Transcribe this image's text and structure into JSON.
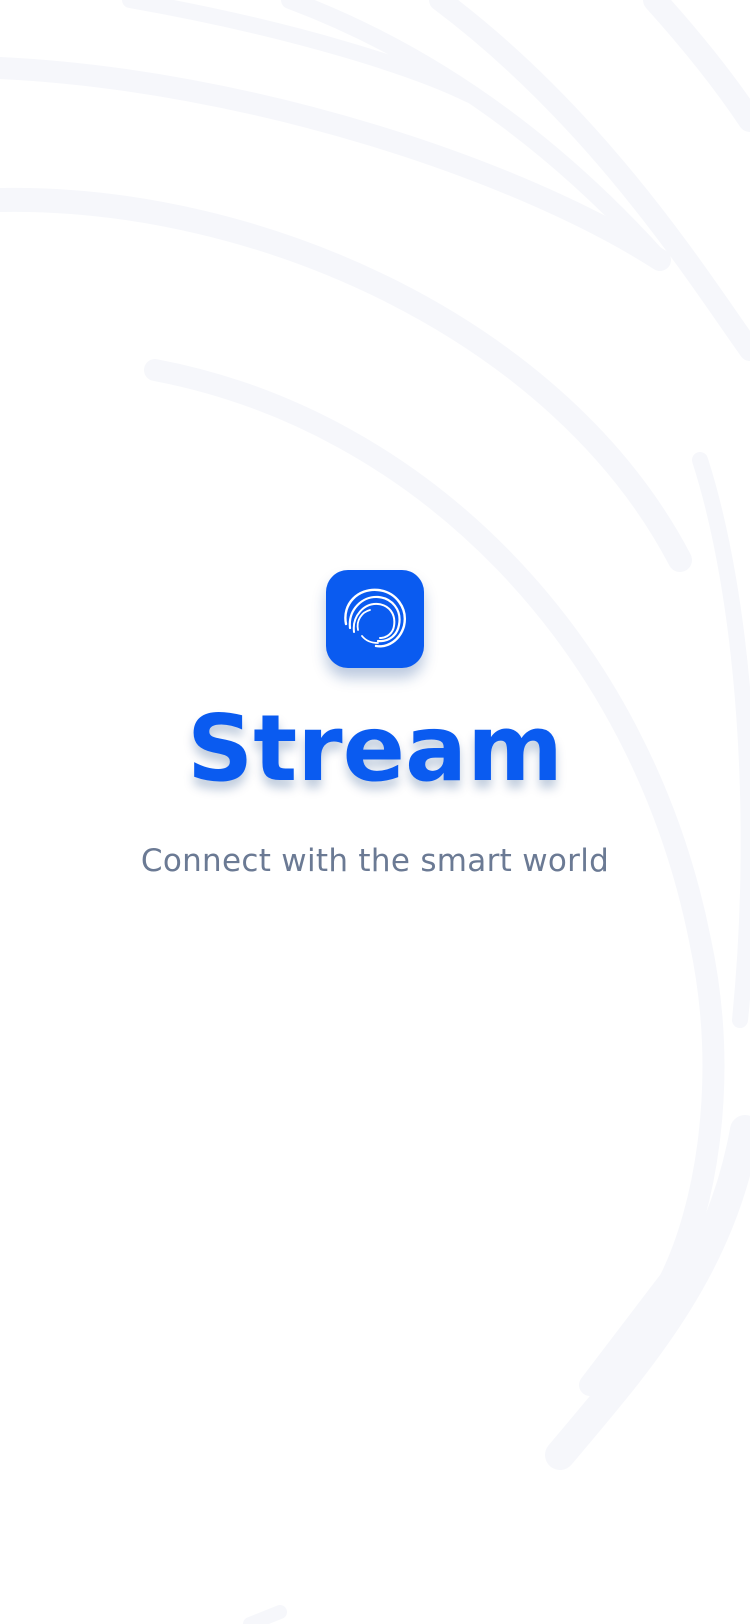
{
  "splash": {
    "app_name": "Stream",
    "tagline": "Connect with the smart world",
    "logo_icon": "stream-swirl-icon"
  },
  "colors": {
    "brand_blue": "#0A5BF0",
    "tagline_gray": "#6B7A94",
    "background": "#FFFFFF",
    "decor_arcs": "#F6F7FB"
  }
}
